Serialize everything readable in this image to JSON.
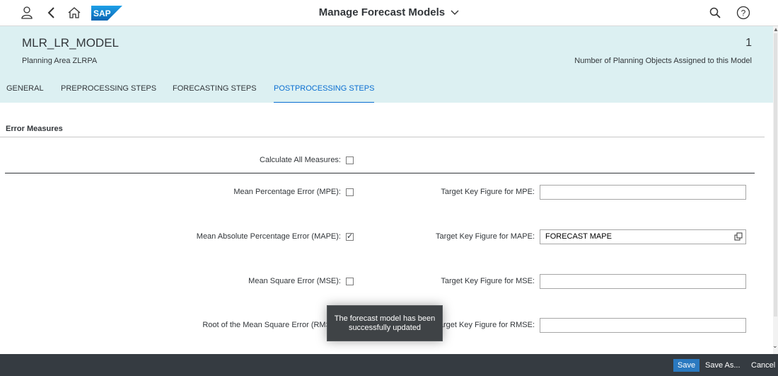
{
  "shell": {
    "title": "Manage Forecast Models",
    "logo_text": "SAP",
    "icons": [
      "user-icon",
      "back-icon",
      "home-icon",
      "search-icon",
      "help-icon",
      "chevron-down-icon"
    ]
  },
  "header": {
    "title": "MLR_LR_MODEL",
    "subtitle": "Planning Area ZLRPA",
    "kpi_value": "1",
    "kpi_label": "Number of Planning Objects Assigned to this Model"
  },
  "tabs": [
    {
      "label": "GENERAL",
      "active": false
    },
    {
      "label": "PREPROCESSING STEPS",
      "active": false
    },
    {
      "label": "FORECASTING STEPS",
      "active": false
    },
    {
      "label": "POSTPROCESSING STEPS",
      "active": true
    }
  ],
  "section": {
    "title": "Error Measures",
    "calc_all_label": "Calculate All Measures:",
    "calc_all_checked": false
  },
  "rows": [
    {
      "label": "Mean Percentage Error (MPE):",
      "checked": false,
      "target_label": "Target Key Figure for MPE:",
      "target_value": ""
    },
    {
      "label": "Mean Absolute Percentage Error (MAPE):",
      "checked": true,
      "target_label": "Target Key Figure for MAPE:",
      "target_value": "FORECAST MAPE"
    },
    {
      "label": "Mean Square Error (MSE):",
      "checked": false,
      "target_label": "Target Key Figure for MSE:",
      "target_value": ""
    },
    {
      "label": "Root of the Mean Square Error (RMSE):",
      "checked": false,
      "target_label": "Target Key Figure for RMSE:",
      "target_value": ""
    }
  ],
  "toast": {
    "message": "The forecast model has been successfully updated"
  },
  "footer": {
    "save": "Save",
    "save_as": "Save As...",
    "cancel": "Cancel"
  },
  "colors": {
    "accent": "#0a6ed1",
    "header_bg": "#dcf0f2",
    "footer_bg": "#353b41",
    "primary_button": "#2a79c0"
  }
}
